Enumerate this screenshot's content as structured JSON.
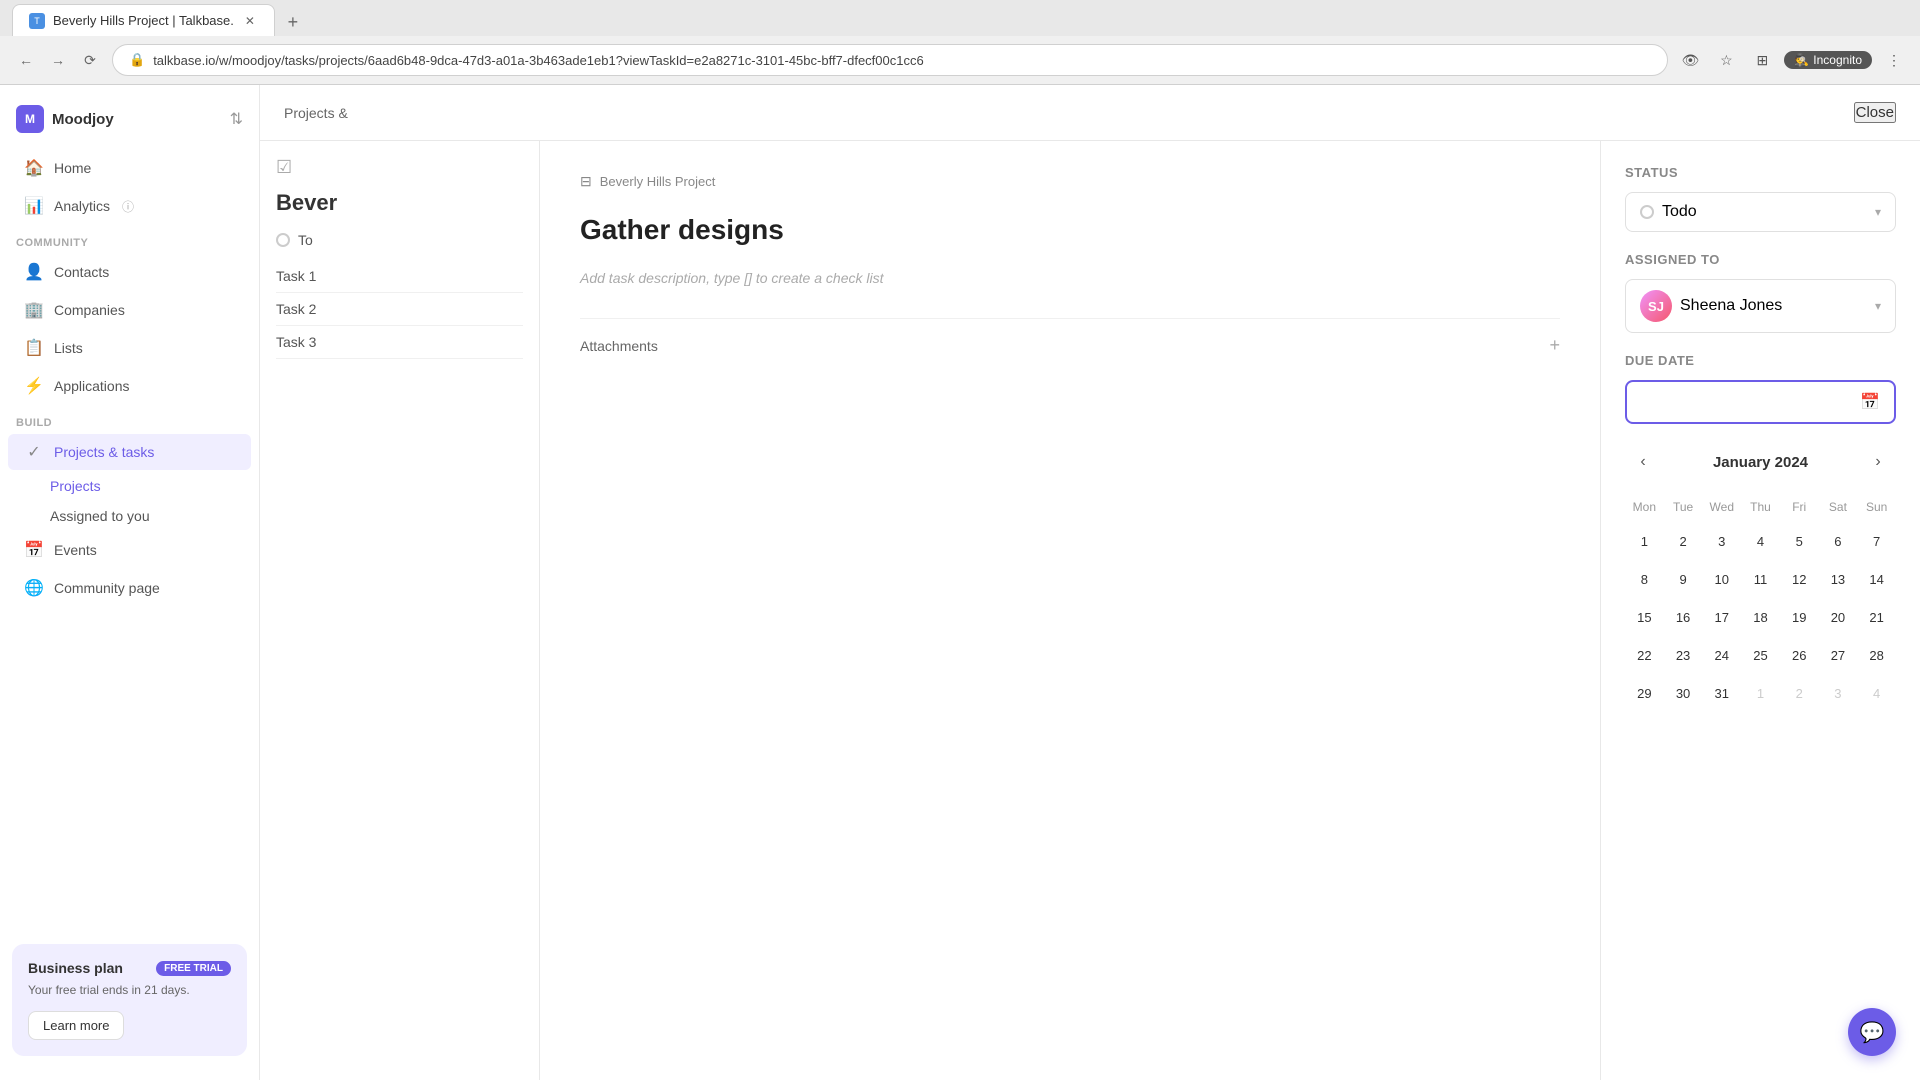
{
  "browser": {
    "tab_title": "Beverly Hills Project | Talkbase.",
    "tab_favicon": "T",
    "url": "talkbase.io/w/moodjoy/tasks/projects/6aad6b48-9dca-47d3-a01a-3b463ade1eb1?viewTaskId=e2a8271c-3101-45bc-bff7-dfecf00c1cc6",
    "incognito_label": "Incognito",
    "new_tab_label": "+"
  },
  "sidebar": {
    "logo_initial": "M",
    "workspace_name": "Moodjoy",
    "nav_items": [
      {
        "id": "home",
        "label": "Home",
        "icon": "🏠"
      },
      {
        "id": "analytics",
        "label": "Analytics",
        "icon": "📊",
        "has_info": true
      }
    ],
    "community_section": "COMMUNITY",
    "community_items": [
      {
        "id": "contacts",
        "label": "Contacts",
        "icon": "👤"
      },
      {
        "id": "companies",
        "label": "Companies",
        "icon": "🏢"
      },
      {
        "id": "lists",
        "label": "Lists",
        "icon": "📋"
      },
      {
        "id": "applications",
        "label": "Applications",
        "icon": "⚡"
      }
    ],
    "build_section": "BUILD",
    "build_items": [
      {
        "id": "projects-tasks",
        "label": "Projects & tasks",
        "icon": "✓"
      }
    ],
    "sub_items": [
      {
        "id": "projects",
        "label": "Projects"
      },
      {
        "id": "assigned-to-you",
        "label": "Assigned to you"
      }
    ],
    "other_items": [
      {
        "id": "events",
        "label": "Events",
        "icon": "📅"
      },
      {
        "id": "community-page",
        "label": "Community page",
        "icon": "🌐"
      }
    ],
    "business_plan": {
      "title": "Business plan",
      "badge": "FREE TRIAL",
      "description": "Your free trial ends in 21 days.",
      "button_label": "Learn more"
    }
  },
  "header": {
    "breadcrumb": "Projects &",
    "close_label": "Close"
  },
  "project_panel": {
    "title": "Bever",
    "status_label": "To",
    "tasks": [
      {
        "label": "Task 1"
      },
      {
        "label": "Task 2"
      },
      {
        "label": "Task 3"
      }
    ]
  },
  "task_detail": {
    "breadcrumb_icon": "⊟",
    "breadcrumb_label": "Beverly Hills Project",
    "title": "Gather designs",
    "description_placeholder": "Add task description, type [] to create a check list",
    "attachments_label": "Attachments",
    "attachments_icon": "+"
  },
  "task_meta": {
    "status_label": "Status",
    "status_value": "Todo",
    "assigned_label": "Assigned to",
    "assigned_name": "Sheena Jones",
    "due_date_label": "Due date",
    "due_date_value": "",
    "calendar": {
      "month_label": "January 2024",
      "day_headers": [
        "Mon",
        "Tue",
        "Wed",
        "Thu",
        "Fri",
        "Sat",
        "Sun"
      ],
      "weeks": [
        [
          {
            "num": "1",
            "type": "current"
          },
          {
            "num": "2",
            "type": "current"
          },
          {
            "num": "3",
            "type": "current"
          },
          {
            "num": "4",
            "type": "current"
          },
          {
            "num": "5",
            "type": "current"
          },
          {
            "num": "6",
            "type": "current"
          },
          {
            "num": "7",
            "type": "current"
          }
        ],
        [
          {
            "num": "8",
            "type": "current"
          },
          {
            "num": "9",
            "type": "current"
          },
          {
            "num": "10",
            "type": "current"
          },
          {
            "num": "11",
            "type": "current"
          },
          {
            "num": "12",
            "type": "current"
          },
          {
            "num": "13",
            "type": "current"
          },
          {
            "num": "14",
            "type": "current"
          }
        ],
        [
          {
            "num": "15",
            "type": "current"
          },
          {
            "num": "16",
            "type": "current"
          },
          {
            "num": "17",
            "type": "current"
          },
          {
            "num": "18",
            "type": "current"
          },
          {
            "num": "19",
            "type": "current"
          },
          {
            "num": "20",
            "type": "current"
          },
          {
            "num": "21",
            "type": "current"
          }
        ],
        [
          {
            "num": "22",
            "type": "current"
          },
          {
            "num": "23",
            "type": "current"
          },
          {
            "num": "24",
            "type": "current"
          },
          {
            "num": "25",
            "type": "current"
          },
          {
            "num": "26",
            "type": "current"
          },
          {
            "num": "27",
            "type": "current"
          },
          {
            "num": "28",
            "type": "current"
          }
        ],
        [
          {
            "num": "29",
            "type": "current"
          },
          {
            "num": "30",
            "type": "current"
          },
          {
            "num": "31",
            "type": "current"
          },
          {
            "num": "1",
            "type": "other"
          },
          {
            "num": "2",
            "type": "other"
          },
          {
            "num": "3",
            "type": "other"
          },
          {
            "num": "4",
            "type": "other"
          }
        ]
      ]
    }
  },
  "chat_fab": {
    "icon": "💬"
  }
}
